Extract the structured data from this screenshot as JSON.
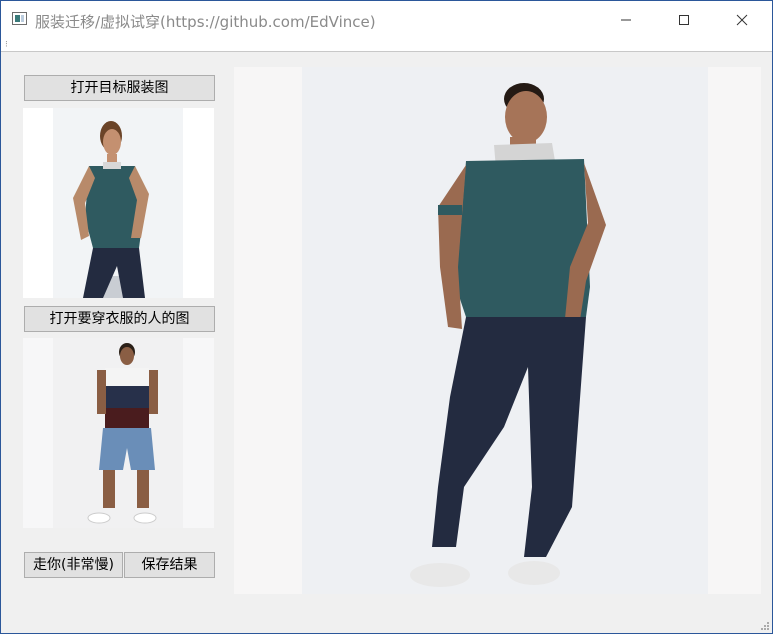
{
  "window": {
    "title": "服装迁移/虚拟试穿(https://github.com/EdVince)",
    "icon": "app-window-icon",
    "border_color": "#2b579a"
  },
  "controls": {
    "open_target_clothing": "打开目标服装图",
    "open_person": "打开要穿衣服的人的图",
    "run": "走你(非常慢)",
    "save": "保存结果"
  },
  "images": {
    "target_clothing": "photo of man in teal polo sitting on stool",
    "person": "photo of man in white-navy-maroon tee and ripped denim shorts",
    "result": "result photo of man in teal polo and dark jeans"
  }
}
